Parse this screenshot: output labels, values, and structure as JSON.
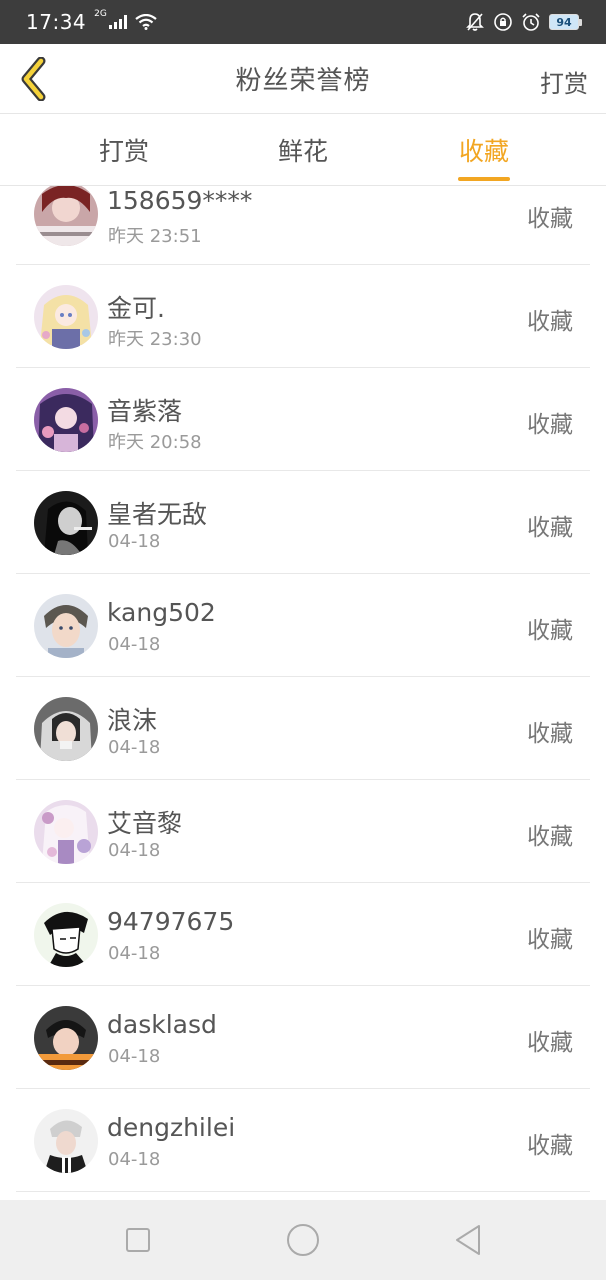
{
  "status_bar": {
    "time": "17:34",
    "network": "2G",
    "battery": "94",
    "icons": [
      "signal-icon",
      "wifi-icon",
      "mute-icon",
      "lock-rotation-icon",
      "alarm-icon",
      "battery-icon"
    ]
  },
  "header": {
    "title": "粉丝荣誉榜",
    "action_label": "打赏",
    "back_icon": "chevron-left-icon",
    "accent_color": "#f2a622"
  },
  "tabs": [
    {
      "label": "打赏",
      "active": false
    },
    {
      "label": "鲜花",
      "active": false
    },
    {
      "label": "收藏",
      "active": true
    }
  ],
  "list": {
    "items": [
      {
        "name": "158659****",
        "time": "昨天 23:51",
        "action": "收藏"
      },
      {
        "name": "金可.",
        "time": "昨天 23:30",
        "action": "收藏"
      },
      {
        "name": "音紫落",
        "time": "昨天 20:58",
        "action": "收藏"
      },
      {
        "name": "皇者无敌",
        "time": "04-18",
        "action": "收藏"
      },
      {
        "name": "kang502",
        "time": "04-18",
        "action": "收藏"
      },
      {
        "name": "浪沫",
        "time": "04-18",
        "action": "收藏"
      },
      {
        "name": "艾音黎",
        "time": "04-18",
        "action": "收藏"
      },
      {
        "name": "94797675",
        "time": "04-18",
        "action": "收藏"
      },
      {
        "name": "dasklasd",
        "time": "04-18",
        "action": "收藏"
      },
      {
        "name": "dengzhilei",
        "time": "04-18",
        "action": "收藏"
      }
    ]
  },
  "nav_bar": {
    "icons": [
      "recent-apps-icon",
      "home-icon",
      "back-icon"
    ]
  }
}
